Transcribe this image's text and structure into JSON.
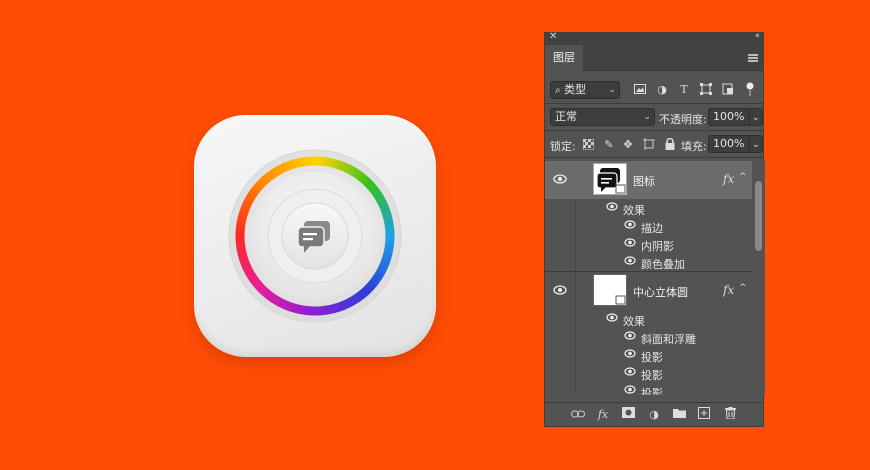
{
  "panel": {
    "tab_label": "图层",
    "filter_kind": "类型",
    "blend_mode": "正常",
    "opacity_label": "不透明度:",
    "opacity_value": "100%",
    "lock_label": "锁定:",
    "fill_label": "填充:",
    "fill_value": "100%"
  },
  "layers": [
    {
      "name": "图标",
      "fx": "fx",
      "selected": true,
      "effects_label": "效果",
      "effects": [
        "描边",
        "内阴影",
        "颜色叠加"
      ]
    },
    {
      "name": "中心立体圆",
      "fx": "fx",
      "selected": false,
      "effects_label": "效果",
      "effects": [
        "斜面和浮雕",
        "投影",
        "投影",
        "投影"
      ]
    }
  ],
  "bottom_toolbar": {
    "fx_label": "fx",
    "icons": [
      "link-icon",
      "fx-icon",
      "mask-icon",
      "adjustment-icon",
      "folder-icon",
      "new-layer-icon",
      "trash-icon"
    ]
  },
  "colors": {
    "background": "#ff4d05",
    "panel": "#535353",
    "selected_layer": "#6b6b6b",
    "ring_colors": [
      "#ffd400",
      "#33c21f",
      "#1fa0e6",
      "#2a3fd6",
      "#8c1fd6",
      "#e81f9a",
      "#ff2a1f",
      "#ff8a00"
    ]
  }
}
